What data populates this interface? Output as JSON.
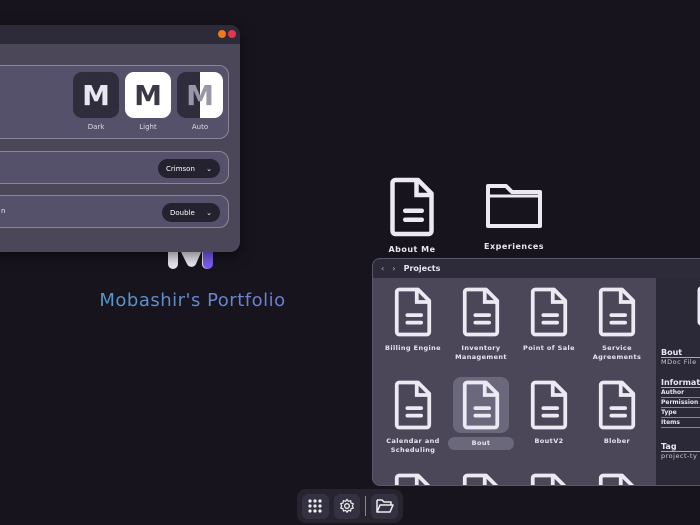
{
  "colors": {
    "bg": "#17141d",
    "window": "#4b4759",
    "titlebar": "#2d2a3a",
    "close": "#e8354f",
    "minimize": "#f07a1a",
    "accent": "#7b5cf0"
  },
  "desktop": {
    "title": "Mobashir's Portfolio",
    "icons": [
      {
        "label": "About Me",
        "icon": "document-icon"
      },
      {
        "label": "Experiences",
        "icon": "folder-icon"
      }
    ]
  },
  "settings": {
    "themes": [
      {
        "label": "Dark",
        "letter": "M"
      },
      {
        "label": "Light",
        "letter": "M"
      },
      {
        "label": "Auto",
        "letter": "M"
      }
    ],
    "rows": [
      {
        "label": "",
        "value": "Crimson"
      },
      {
        "label": "n",
        "value": "Double"
      }
    ]
  },
  "projects": {
    "title": "Projects",
    "back": "‹",
    "forward": "›",
    "items": [
      {
        "label": "Billing Engine"
      },
      {
        "label": "Inventory Management"
      },
      {
        "label": "Point of Sale"
      },
      {
        "label": "Service Agreements"
      },
      {
        "label": "Calendar and Scheduling"
      },
      {
        "label": "Bout"
      },
      {
        "label": "BoutV2"
      },
      {
        "label": "Blober"
      },
      {
        "label": ""
      },
      {
        "label": ""
      },
      {
        "label": ""
      },
      {
        "label": ""
      }
    ],
    "selected": "Bout",
    "info": {
      "name": "Bout",
      "type": "MDoc File",
      "section": "Informat",
      "fields": [
        "Author",
        "Permission",
        "Type",
        "Items"
      ],
      "tag_heading": "Tag",
      "tag": "project-ty"
    }
  },
  "dock": [
    "apps-grid-icon",
    "settings-gear-icon",
    "folder-open-icon"
  ]
}
